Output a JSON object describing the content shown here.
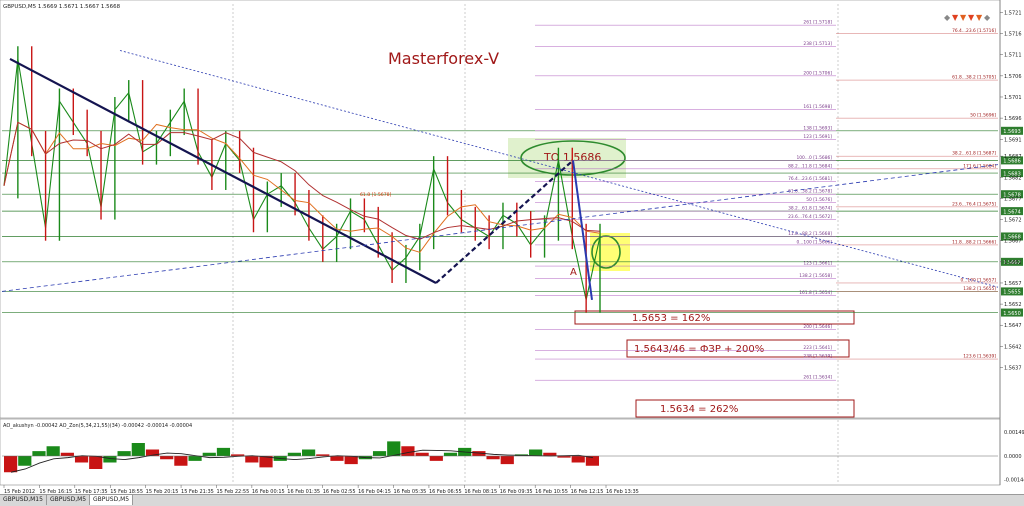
{
  "window": {
    "symbol_header": "GBPUSD,M5  1.5669 1.5671 1.5667 1.5668",
    "tabs": [
      {
        "label": "GBPUSD,M15",
        "active": false
      },
      {
        "label": "GBPUSD,M5",
        "active": false
      },
      {
        "label": "GBPUSD,M5",
        "active": true
      }
    ]
  },
  "annotations": {
    "brand": "Masterforex-V",
    "target": "TO 1.5686",
    "point_a": "A",
    "box_162": "1.5653 = 162%",
    "box_200": "1.5643/46 = ФЗР + 200%",
    "box_262": "1.5634 = 262%"
  },
  "colors": {
    "up_bar": "#1a8a1a",
    "down_bar": "#c81414",
    "fib_grid": "#b060c0",
    "horizontal_level": "#2e7d2e",
    "trendline": "#141450",
    "channel_dash": "#2a3ab0",
    "annotation": "#a01818"
  },
  "chart_data": [
    {
      "type": "line",
      "title": "GBPUSD,M5",
      "y_axis_ticks": [
        "1.5721",
        "1.5716",
        "1.5711",
        "1.5706",
        "1.5701",
        "1.5696",
        "1.5691",
        "1.5687",
        "1.5682",
        "1.5677",
        "1.5672",
        "1.5667",
        "1.5662",
        "1.5657",
        "1.5652",
        "1.5647",
        "1.5642",
        "1.5637"
      ],
      "ylim": [
        1.5626,
        1.5723
      ],
      "price_labels": [
        "1.5693",
        "1.5686",
        "1.5683",
        "1.5678",
        "1.5674",
        "1.5668",
        "1.5662",
        "1.5655",
        "1.5650"
      ],
      "x_ticks": [
        "15 Feb 2012",
        "15 Feb 16:15",
        "15 Feb 17:35",
        "15 Feb 18:55",
        "15 Feb 20:15",
        "15 Feb 21:35",
        "15 Feb 22:55",
        "16 Feb 00:15",
        "16 Feb 01:35",
        "16 Feb 02:55",
        "16 Feb 04:15",
        "16 Feb 05:35",
        "16 Feb 06:55",
        "16 Feb 08:15",
        "16 Feb 09:35",
        "16 Feb 10:55",
        "16 Feb 12:15",
        "16 Feb 13:35"
      ],
      "series": [
        {
          "name": "",
          "values": [
            1.568,
            1.571,
            1.569,
            1.567,
            1.57,
            1.5695,
            1.569,
            1.5675,
            1.5698,
            1.5702,
            1.5688,
            1.569,
            1.5695,
            1.57,
            1.5688,
            1.5682,
            1.569,
            1.5686,
            1.5672,
            1.5678,
            1.568,
            1.5676,
            1.567,
            1.5665,
            1.5668,
            1.5674,
            1.5672,
            1.5666,
            1.566,
            1.5663,
            1.5668,
            1.5684,
            1.5676,
            1.5672,
            1.567,
            1.5668,
            1.5673,
            1.5671,
            1.5666,
            1.567,
            1.5686,
            1.5668,
            1.5653,
            1.5668
          ]
        }
      ],
      "fib_levels": [
        {
          "label": "261 [1.5718]",
          "value": 1.5718
        },
        {
          "label": "238 [1.5713]",
          "value": 1.5713
        },
        {
          "label": "200 [1.5706]",
          "value": 1.5706
        },
        {
          "label": "161 [1.5698]",
          "value": 1.5698
        },
        {
          "label": "138 [1.5693]",
          "value": 1.5693
        },
        {
          "label": "123 [1.5691]",
          "value": 1.5691
        },
        {
          "label": "100...0 [1.5686]",
          "value": 1.5686
        },
        {
          "label": "88.2...11.8 [1.5684]",
          "value": 1.5684
        },
        {
          "label": "76.4...23.6 [1.5681]",
          "value": 1.5681
        },
        {
          "label": "61.8...38.2 [1.5678]",
          "value": 1.5678
        },
        {
          "label": "50 [1.5676]",
          "value": 1.5676
        },
        {
          "label": "38.2...61.8 [1.5674]",
          "value": 1.5674
        },
        {
          "label": "23.6...76.4 [1.5672]",
          "value": 1.5672
        },
        {
          "label": "11.8...88.2 [1.5668]",
          "value": 1.5668
        },
        {
          "label": "0...100 [1.5666]",
          "value": 1.5666
        },
        {
          "label": "123 [1.5661]",
          "value": 1.5661
        },
        {
          "label": "138.2 [1.5658]",
          "value": 1.5658
        },
        {
          "label": "161.8 [1.5654]",
          "value": 1.5654
        },
        {
          "label": "200 [1.5646]",
          "value": 1.5646
        },
        {
          "label": "223 [1.5641]",
          "value": 1.5641
        },
        {
          "label": "238 [1.5639]",
          "value": 1.5639
        },
        {
          "label": "261 [1.5634]",
          "value": 1.5634
        }
      ],
      "fib_levels_right": [
        {
          "label": "76.4...23.6 [1.5716]",
          "value": 1.5716
        },
        {
          "label": "61.8...38.2 [1.5705]",
          "value": 1.5705
        },
        {
          "label": "50 [1.5696]",
          "value": 1.5696
        },
        {
          "label": "38.2...61.8 [1.5687]",
          "value": 1.5687
        },
        {
          "label": "23.6...76.4 [1.5675]",
          "value": 1.5675
        },
        {
          "label": "11.8...88.2 [1.5666]",
          "value": 1.5666
        },
        {
          "label": "0...100 [1.5657]",
          "value": 1.5657
        },
        {
          "label": "138.2 [1.5655]",
          "value": 1.5655
        },
        {
          "label": "123.6 [1.5639]",
          "value": 1.5639
        },
        {
          "label": "171.6 [1.5684]",
          "value": 1.5684
        }
      ],
      "small_level_label": "61.8 [1.5678]"
    },
    {
      "type": "bar",
      "title": "AO_akushyn -0.00042  AO_Zon(5,34,21,55)(34) -0.00042 -0.00014 -0.00004",
      "y_axis_ticks": [
        "0.00149",
        "0.0000",
        "-0.00144"
      ],
      "ylim": [
        -0.0016,
        0.0016
      ],
      "values": [
        -0.001,
        -0.0006,
        0.0003,
        0.0006,
        0.0002,
        -0.0004,
        -0.0008,
        -0.0004,
        0.0003,
        0.0008,
        0.0004,
        -0.0002,
        -0.0006,
        -0.0003,
        0.0002,
        0.0005,
        0.0001,
        -0.0004,
        -0.0007,
        -0.0003,
        0.0002,
        0.0004,
        0.0001,
        -0.0003,
        -0.0005,
        -0.0002,
        0.0003,
        0.0009,
        0.0006,
        0.0002,
        -0.0003,
        0.0002,
        0.0005,
        0.0003,
        -0.0002,
        -0.0005,
        0.0001,
        0.0004,
        0.0002,
        -0.0001,
        -0.0004,
        -0.0006
      ]
    }
  ]
}
